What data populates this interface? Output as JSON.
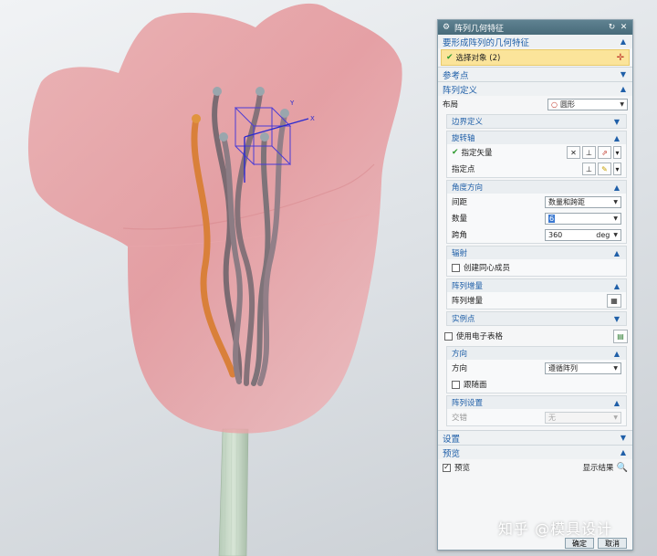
{
  "dialog": {
    "title": "阵列几何特征",
    "sections": {
      "geom": {
        "title": "要形成阵列的几何特征",
        "select_label": "选择对象 (2)"
      },
      "refpoint": {
        "title": "参考点"
      },
      "pattern_def": {
        "title": "阵列定义",
        "layout_label": "布局",
        "layout_value": "圆形",
        "boundary_title": "边界定义",
        "rot_axis_title": "旋转轴",
        "vector_label": "指定矢量",
        "point_label": "指定点",
        "angle_title": "角度方向",
        "spacing_label": "间距",
        "spacing_value": "数量和跨距",
        "count_label": "数量",
        "count_value": "6",
        "span_label": "跨角",
        "span_value": "360",
        "span_unit": "deg",
        "radiate_title": "辐射",
        "concentric_label": "创建同心成员",
        "increment_title": "阵列增量",
        "increment_label": "阵列增量",
        "instance_title": "实例点",
        "spreadsheet_label": "使用电子表格",
        "direction_title": "方向",
        "direction_label": "方向",
        "direction_value": "遵循阵列",
        "follow_face_label": "跟随面",
        "settings_title": "阵列设置",
        "stagger_label": "交错",
        "stagger_value": "无"
      },
      "settings": {
        "title": "设置"
      },
      "preview": {
        "title": "预览",
        "preview_label": "预览",
        "show_result_label": "显示结果"
      }
    },
    "buttons": {
      "ok": "确定",
      "cancel": "取消"
    }
  },
  "viewport": {
    "axis_x": "X",
    "axis_y": "Y"
  },
  "watermark": "知乎 @模具设计"
}
